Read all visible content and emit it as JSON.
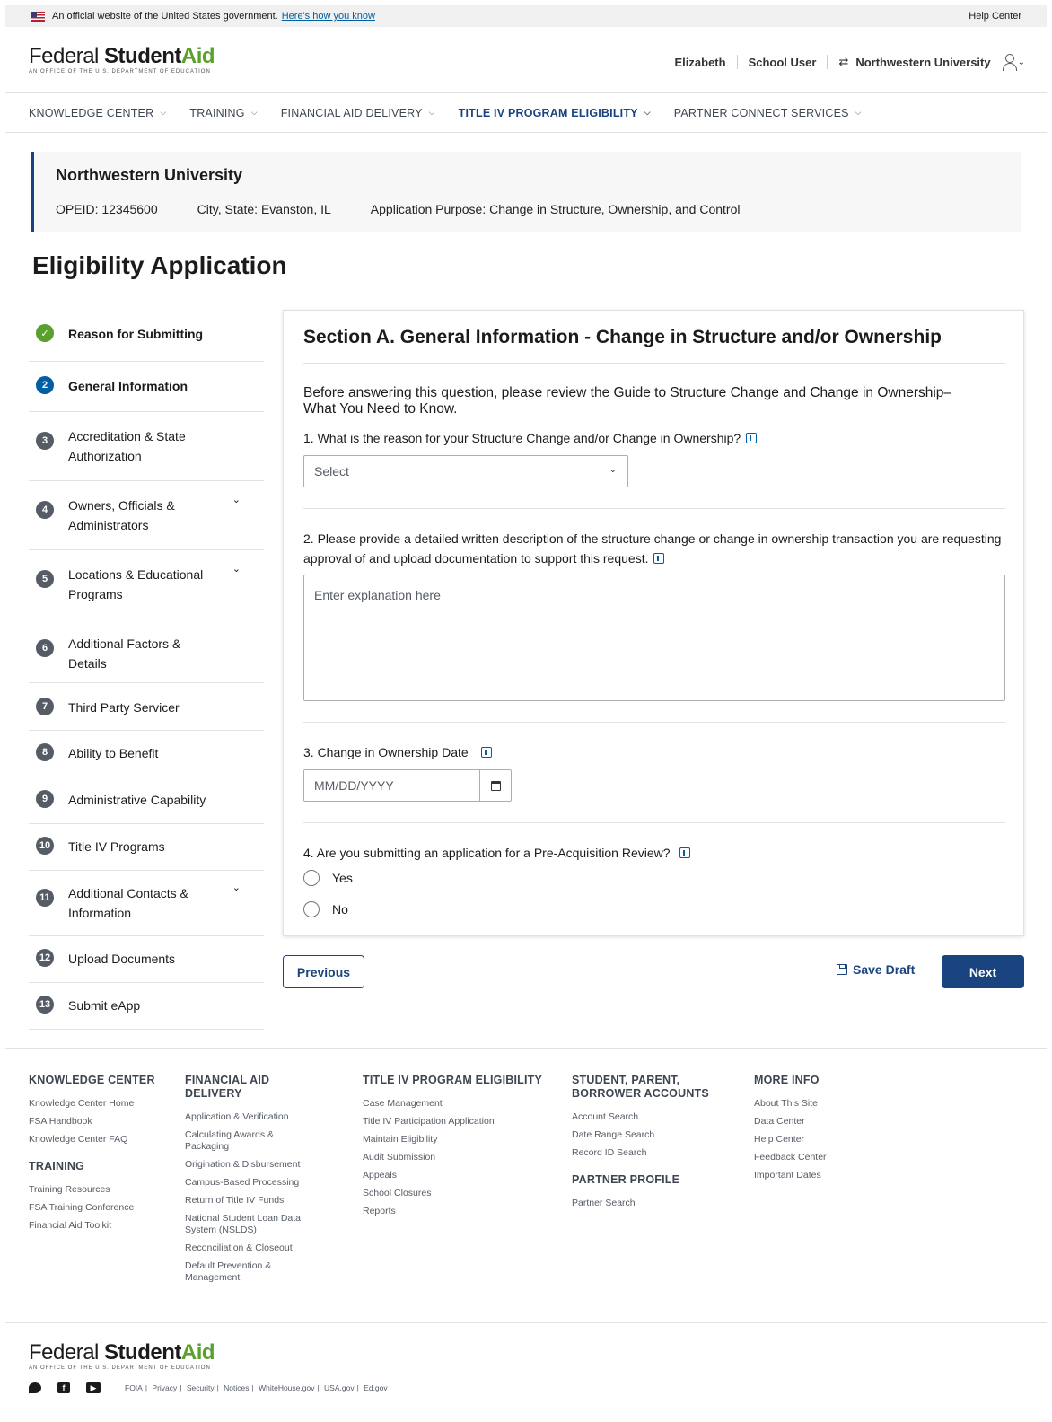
{
  "gov_banner": {
    "text": "An official website of the United States government.",
    "link": "Here's how you know",
    "help": "Help Center"
  },
  "header": {
    "logo_federal": "Federal",
    "logo_student": "Student",
    "logo_aid": "Aid",
    "logo_sub": "An OFFICE of the U.S. DEPARTMENT of EDUCATION",
    "user_name": "Elizabeth",
    "user_role": "School User",
    "institution": "Northwestern University"
  },
  "nav": [
    {
      "label": "KNOWLEDGE CENTER"
    },
    {
      "label": "TRAINING"
    },
    {
      "label": "FINANCIAL AID DELIVERY"
    },
    {
      "label": "TITLE IV PROGRAM ELIGIBILITY"
    },
    {
      "label": "PARTNER CONNECT SERVICES"
    }
  ],
  "school": {
    "name": "Northwestern University",
    "opeid": "OPEID: 12345600",
    "city_state": "City, State: Evanston, IL",
    "purpose": "Application Purpose: Change in Structure, Ownership, and Control"
  },
  "page_title": "Eligibility Application",
  "steps": [
    {
      "num": "✓",
      "label": "Reason for Submitting"
    },
    {
      "num": "2",
      "label": "General Information"
    },
    {
      "num": "3",
      "label": "Accreditation & State Authorization"
    },
    {
      "num": "4",
      "label": "Owners, Officials & Administrators"
    },
    {
      "num": "5",
      "label": "Locations & Educational Programs"
    },
    {
      "num": "6",
      "label": "Additional Factors & Details"
    },
    {
      "num": "7",
      "label": "Third Party Servicer"
    },
    {
      "num": "8",
      "label": "Ability to Benefit"
    },
    {
      "num": "9",
      "label": "Administrative Capability"
    },
    {
      "num": "10",
      "label": "Title IV Programs"
    },
    {
      "num": "11",
      "label": "Additional Contacts & Information"
    },
    {
      "num": "12",
      "label": "Upload Documents"
    },
    {
      "num": "13",
      "label": "Submit eApp"
    }
  ],
  "form": {
    "section_title": "Section A. General Information - Change in Structure and/or Ownership",
    "intro": "Before answering this question, please review the Guide to Structure Change and Change in Ownership–What You Need to Know.",
    "q1": "1. What is the reason for your Structure Change and/or Change in Ownership?",
    "q1_select": "Select",
    "q2": "2. Please provide a detailed written description of the structure change or change in ownership transaction you are requesting approval of and upload documentation to support this request.",
    "q2_placeholder": "Enter explanation here",
    "q3": "3. Change in Ownership Date",
    "q3_placeholder": "MM/DD/YYYY",
    "q4": "4. Are you submitting an application for a Pre-Acquisition Review?",
    "q4_yes": "Yes",
    "q4_no": "No"
  },
  "actions": {
    "previous": "Previous",
    "save": "Save Draft",
    "next": "Next"
  },
  "footer": {
    "knowledge_center": {
      "head": "KNOWLEDGE CENTER",
      "links": [
        "Knowledge Center Home",
        "FSA Handbook",
        "Knowledge Center FAQ"
      ]
    },
    "training": {
      "head": "TRAINING",
      "links": [
        "Training Resources",
        "FSA Training Conference",
        "Financial Aid Toolkit"
      ]
    },
    "financial_aid_delivery": {
      "head": "FINANCIAL AID DELIVERY",
      "links": [
        "Application & Verification",
        "Calculating Awards & Packaging",
        "Origination & Disbursement",
        "Campus-Based Processing",
        "Return of Title IV Funds",
        "National Student Loan Data System (NSLDS)",
        "Reconciliation & Closeout",
        "Default Prevention & Management"
      ]
    },
    "title_iv": {
      "head": "TITLE IV PROGRAM ELIGIBILITY",
      "links": [
        "Case Management",
        "Title IV Participation Application",
        "Maintain Eligibility",
        "Audit Submission",
        "Appeals",
        "School Closures",
        "Reports"
      ]
    },
    "accounts": {
      "head": "STUDENT, PARENT, BORROWER ACCOUNTS",
      "links": [
        "Account Search",
        "Date Range Search",
        "Record ID Search"
      ]
    },
    "partner": {
      "head": "PARTNER PROFILE",
      "links": [
        "Partner Search"
      ]
    },
    "more_info": {
      "head": "MORE INFO",
      "links": [
        "About This Site",
        "Data Center",
        "Help Center",
        "Feedback Center",
        "Important Dates"
      ]
    },
    "legal": [
      "FOIA",
      "Privacy",
      "Security",
      "Notices",
      "WhiteHouse.gov",
      "USA.gov",
      "Ed.gov"
    ]
  }
}
